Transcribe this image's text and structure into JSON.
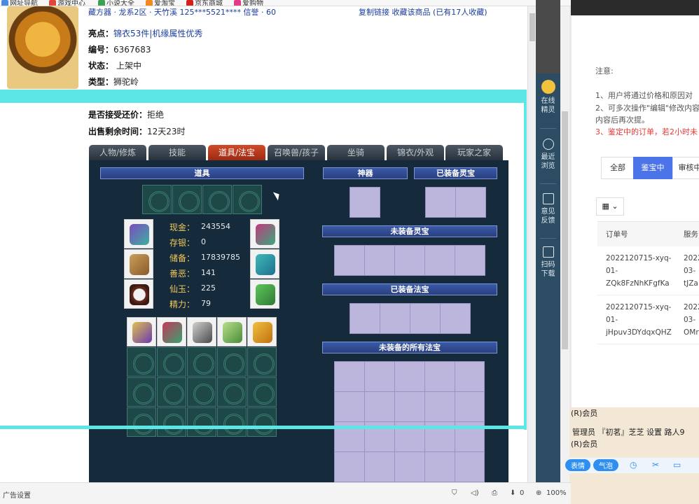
{
  "bookmarks": [
    {
      "label": "网址导航",
      "color": "#4b8ae0"
    },
    {
      "label": "游戏中心",
      "color": "#e2453a"
    },
    {
      "label": "小说大全",
      "color": "#3aa155"
    },
    {
      "label": "爱淘宝",
      "color": "#f08a1c"
    },
    {
      "label": "京东商城",
      "color": "#d4201f"
    },
    {
      "label": "爱购物",
      "color": "#e43a8c"
    }
  ],
  "seller": {
    "line": "藏方器 · 龙系2区 · 天竹溪   125***5521****   信誉 · 60",
    "links": "复制链接   收藏该商品   (已有17人收藏)"
  },
  "item": {
    "highlight_label": "亮点：",
    "highlight_value": "锦衣53件|机缘属性优秀",
    "id_label": "编号：",
    "id_value": "6367683",
    "status_label": "状态：",
    "status_value": "上架中",
    "type_label": "类型：",
    "type_value": "狮驼岭",
    "bargain_label": "是否接受还价：",
    "bargain_value": "拒绝",
    "remaining_label": "出售剩余时间：",
    "remaining_value": "12天23时"
  },
  "tabs": [
    "人物/修炼",
    "技能",
    "道具/法宝",
    "召唤兽/孩子",
    "坐骑",
    "锦衣/外观",
    "玩家之家"
  ],
  "active_tab": 2,
  "panel": {
    "props_header": "道具",
    "artifact_header": "神器",
    "equipped_spirit_header": "已装备灵宝",
    "unequipped_spirit_header": "未装备灵宝",
    "equipped_magic_header": "已装备法宝",
    "all_magic_header": "未装备的所有法宝"
  },
  "stats": [
    {
      "label": "现金：",
      "value": "243554"
    },
    {
      "label": "存银：",
      "value": "0"
    },
    {
      "label": "储备：",
      "value": "17839785"
    },
    {
      "label": "善恶：",
      "value": "141"
    },
    {
      "label": "仙玉：",
      "value": "225"
    },
    {
      "label": "精力：",
      "value": "79"
    }
  ],
  "sidebar": [
    {
      "label": "在线精灵"
    },
    {
      "label": "最近浏览"
    },
    {
      "label": "意见反馈"
    },
    {
      "label": "扫码下载"
    }
  ],
  "right_panel": {
    "note_title": "注意:",
    "note_1": "1、用户将通过价格和原因对",
    "note_2": "2、可多次操作\"编辑\"修改内容",
    "note_2b": "内容后再次提。",
    "note_3": "3、鉴定中的订单，若2小时未",
    "filters": [
      "全部",
      "鉴宝中",
      "审核中"
    ],
    "col_order": "订单号",
    "col_service": "服务",
    "rows": [
      {
        "order": [
          "2022120715-xyq-",
          "01-",
          "ZQk8FzNhKFgfKa"
        ],
        "service": [
          "2022",
          "03-",
          "tJZa"
        ]
      },
      {
        "order": [
          "2022120715-xyq-",
          "01-",
          "jHpuv3DYdqxQHZ"
        ],
        "service": [
          "2022",
          "03-",
          "OMr"
        ]
      }
    ]
  },
  "forum": {
    "line1": "(R)会员",
    "line2": "管理员 『初茗』芝芝 设置 路人9",
    "line3": "(R)会员",
    "chip1": "表情",
    "chip2": "气泡"
  },
  "statusbar": {
    "left": "广告设置",
    "zoom": "100%",
    "downloads": "0"
  }
}
